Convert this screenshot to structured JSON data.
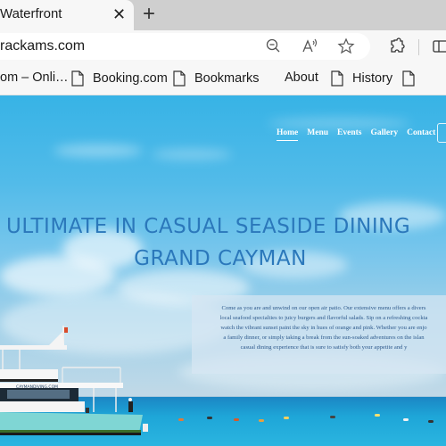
{
  "browser": {
    "tab": {
      "title": "Waterfront",
      "close_icon": "close-icon"
    },
    "new_tab_icon": "plus-icon",
    "address_bar": {
      "url": "rackams.com"
    },
    "omnibox_icons": [
      "zoom-out-icon",
      "read-aloud-icon",
      "favorite-star-icon"
    ],
    "toolbar_icons": [
      "extensions-icon",
      "split-screen-icon"
    ],
    "bookmarks": [
      {
        "label": "om – Onli…",
        "icon": null
      },
      {
        "label": "Booking.com",
        "icon": "page-icon"
      },
      {
        "label": "Bookmarks",
        "icon": "page-icon"
      },
      {
        "label": "About",
        "icon": null
      },
      {
        "label": "History",
        "icon": "page-icon"
      },
      {
        "label": "",
        "icon": "page-icon"
      }
    ]
  },
  "site": {
    "nav": [
      {
        "label": "Home",
        "active": true
      },
      {
        "label": "Menu",
        "active": false
      },
      {
        "label": "Events",
        "active": false
      },
      {
        "label": "Gallery",
        "active": false
      },
      {
        "label": "Contact",
        "active": false
      }
    ],
    "hero": {
      "headline_line1": "ULTIMATE IN CASUAL SEASIDE DINING",
      "headline_line2": "GRAND CAYMAN",
      "description_lines": [
        "Come as you are and unwind on our open air patio. Our extensive menu offers a divers",
        "local seafood specialties to juicy burgers and flavorful salads. Sip on a refreshing cockta",
        "watch the vibrant sunset paint the sky in hues of orange and pink. Whether you are enjo",
        "a family dinner, or simply taking a break from the sun-soaked adventures on the islan",
        "casual dining experience that is sure to satisfy both your appetite and y"
      ]
    },
    "boat_label": "CAYMANDIVING.COM",
    "colors": {
      "headline": "#2b78bb",
      "body_text": "#2f5a8c",
      "sky": "#37b3e6",
      "sea": "#1ea6d8"
    }
  }
}
